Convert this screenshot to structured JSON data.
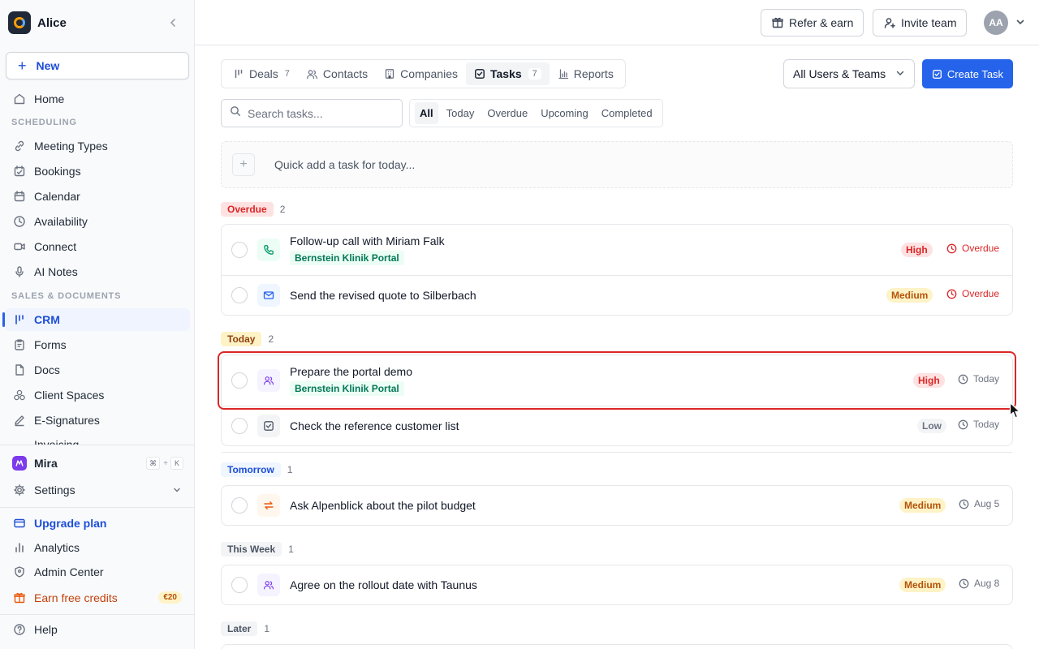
{
  "workspace": {
    "name": "Alice"
  },
  "sidebar": {
    "new_label": "New",
    "home": "Home",
    "section_scheduling": "SCHEDULING",
    "scheduling": [
      "Meeting Types",
      "Bookings",
      "Calendar",
      "Availability",
      "Connect",
      "AI Notes"
    ],
    "section_sales": "SALES & DOCUMENTS",
    "sales": [
      "CRM",
      "Forms",
      "Docs",
      "Client Spaces",
      "E-Signatures",
      "Invoicing"
    ],
    "active_item": "CRM",
    "mira": {
      "label": "Mira",
      "shortcut_mod": "⌘",
      "shortcut_plus": "+",
      "shortcut_key": "K"
    },
    "settings": "Settings",
    "upgrade": "Upgrade plan",
    "analytics": "Analytics",
    "admin": "Admin Center",
    "earn": {
      "label": "Earn free credits",
      "badge": "€20"
    },
    "help": "Help"
  },
  "topbar": {
    "refer": "Refer & earn",
    "invite": "Invite team",
    "avatar_initials": "AA"
  },
  "tabs": [
    {
      "label": "Deals",
      "count": "7",
      "icon": "pipeline-icon"
    },
    {
      "label": "Contacts",
      "count": "",
      "icon": "users-icon"
    },
    {
      "label": "Companies",
      "count": "",
      "icon": "building-icon"
    },
    {
      "label": "Tasks",
      "count": "7",
      "icon": "checkbox-icon",
      "active": true
    },
    {
      "label": "Reports",
      "count": "",
      "icon": "bar-chart-icon"
    }
  ],
  "users_filter": "All Users & Teams",
  "create_task": "Create Task",
  "search": {
    "placeholder": "Search tasks..."
  },
  "filters": [
    "All",
    "Today",
    "Overdue",
    "Upcoming",
    "Completed"
  ],
  "active_filter": "All",
  "quick_add": "Quick add a task for today...",
  "groups": [
    {
      "label": "Overdue",
      "count": "2",
      "color": "#dc2626",
      "bg": "#fee2e2",
      "tasks": [
        {
          "title": "Follow-up call with Miriam Falk",
          "tag": "Bernstein Klinik Portal",
          "type": "phone-icon",
          "priority": "High",
          "due": "Overdue"
        },
        {
          "title": "Send the revised quote to Silberbach",
          "tag": "",
          "type": "mail-icon",
          "priority": "Medium",
          "due": "Overdue"
        }
      ]
    },
    {
      "label": "Today",
      "count": "2",
      "color": "#92400e",
      "bg": "#fef3c7",
      "tasks": [
        {
          "title": "Prepare the portal demo",
          "tag": "Bernstein Klinik Portal",
          "type": "meeting-icon",
          "priority": "High",
          "due": "Today"
        },
        {
          "title": "Check the reference customer list",
          "tag": "",
          "type": "todo-icon",
          "priority": "Low",
          "due": "Today"
        }
      ]
    },
    {
      "label": "Tomorrow",
      "count": "1",
      "color": "#1d4ed8",
      "bg": "#eff6ff",
      "tasks": [
        {
          "title": "Ask Alpenblick about the pilot budget",
          "tag": "",
          "type": "follow-up-icon",
          "priority": "Medium",
          "due": "Aug 5"
        }
      ]
    },
    {
      "label": "This Week",
      "count": "1",
      "color": "#4b5563",
      "bg": "#f3f4f6",
      "tasks": [
        {
          "title": "Agree on the rollout date with Taunus",
          "tag": "",
          "type": "meeting-icon",
          "priority": "Medium",
          "due": "Aug 8"
        }
      ]
    },
    {
      "label": "Later",
      "count": "1",
      "color": "#4b5563",
      "bg": "#f3f4f6",
      "tasks": []
    }
  ],
  "colors": {
    "accent": "#2563eb",
    "high_bg": "#fee2e2",
    "high_fg": "#dc2626",
    "medium_bg": "#fef3c7",
    "medium_fg": "#b45309",
    "low_bg": "#f3f4f6",
    "low_fg": "#6b7280",
    "overdue": "#dc2626"
  }
}
